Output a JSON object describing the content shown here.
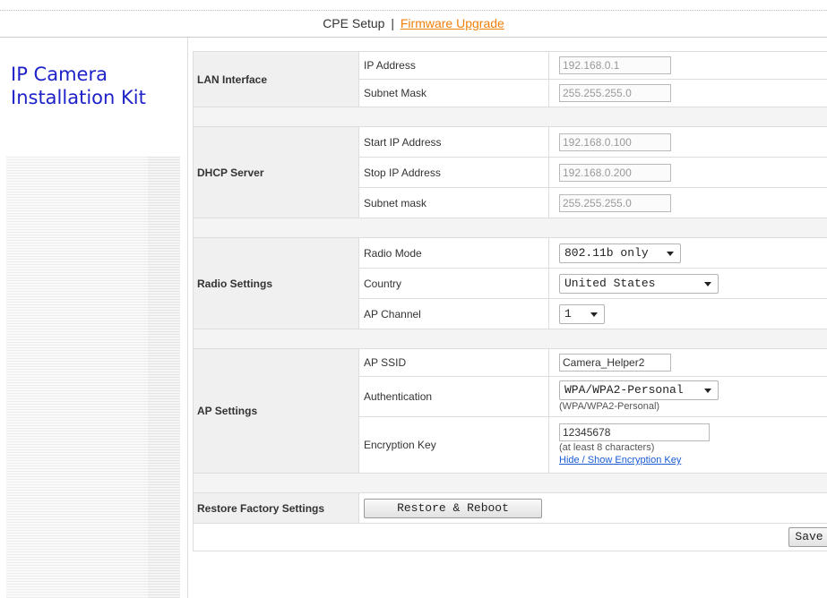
{
  "header": {
    "title": "CPE Setup",
    "separator": "|",
    "firmware_link": "Firmware Upgrade"
  },
  "brand": {
    "line1": "IP Camera",
    "line2": "Installation Kit"
  },
  "lan": {
    "group": "LAN Interface",
    "ip_label": "IP Address",
    "ip_value": "192.168.0.1",
    "mask_label": "Subnet Mask",
    "mask_value": "255.255.255.0"
  },
  "dhcp": {
    "group": "DHCP Server",
    "start_label": "Start IP Address",
    "start_value": "192.168.0.100",
    "stop_label": "Stop IP Address",
    "stop_value": "192.168.0.200",
    "mask_label": "Subnet mask",
    "mask_value": "255.255.255.0"
  },
  "radio": {
    "group": "Radio Settings",
    "mode_label": "Radio Mode",
    "mode_value": "802.11b only",
    "country_label": "Country",
    "country_value": "United States",
    "channel_label": "AP Channel",
    "channel_value": "1"
  },
  "ap": {
    "group": "AP Settings",
    "ssid_label": "AP SSID",
    "ssid_value": "Camera_Helper2",
    "auth_label": "Authentication",
    "auth_value": "WPA/WPA2-Personal",
    "auth_hint": "(WPA/WPA2-Personal)",
    "key_label": "Encryption Key",
    "key_value": "12345678",
    "key_hint": "(at least 8 characters)",
    "key_toggle": "Hide / Show Encryption Key"
  },
  "restore": {
    "group": "Restore Factory Settings",
    "button": "Restore & Reboot"
  },
  "save": {
    "button": "Save"
  },
  "colors": {
    "brand": "#1e22c8",
    "link_orange": "#f07f0a",
    "link_blue": "#1a5cd6"
  }
}
